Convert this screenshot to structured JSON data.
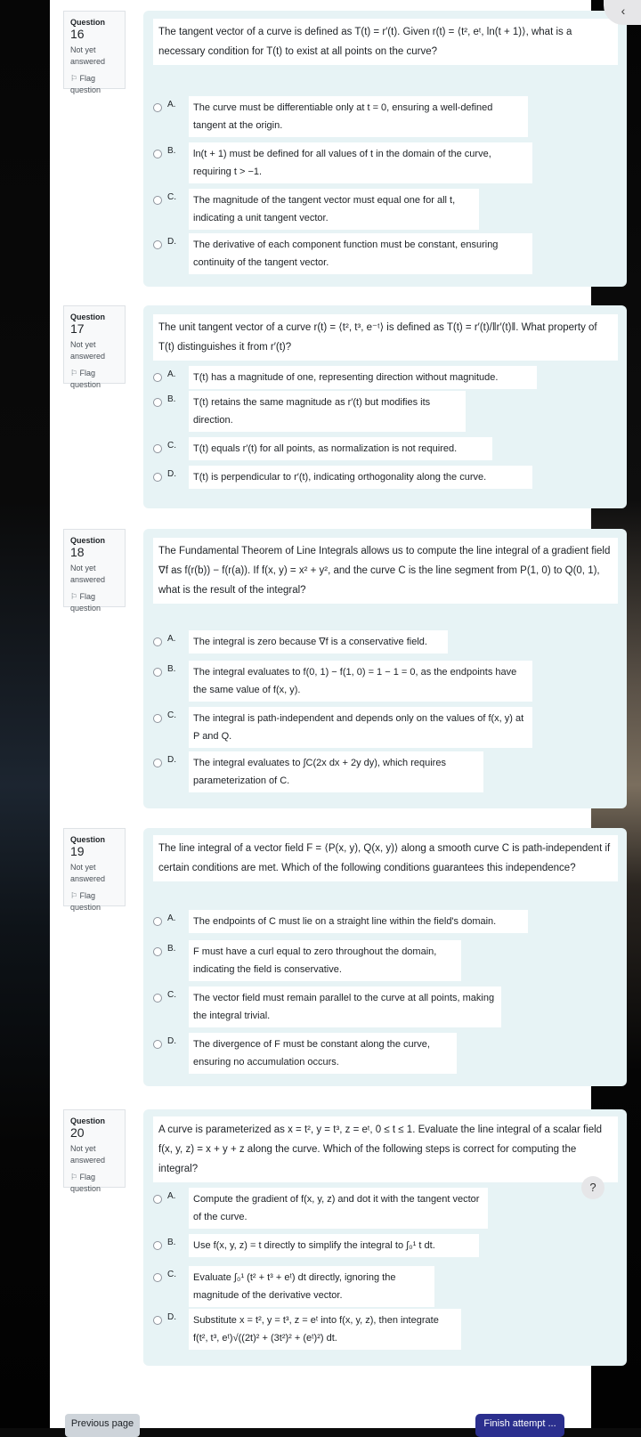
{
  "nav": {
    "back_icon": "chevron-left-icon",
    "help_icon": "question-mark-icon",
    "back_glyph": "‹",
    "help_glyph": "?"
  },
  "questions": [
    {
      "label": "Question",
      "number": "16",
      "status": "Not yet answered",
      "flag": "Flag question",
      "text": "The tangent vector of a curve is defined as T(t) = r′(t). Given r(t) = ⟨t², eᵗ, ln(t + 1)⟩, what is a necessary condition for T(t) to exist at all points on the curve?",
      "options": [
        {
          "letter": "A.",
          "text": "The curve must be differentiable only at t = 0, ensuring a well-defined tangent at the origin."
        },
        {
          "letter": "B.",
          "text": "ln(t + 1) must be defined for all values of t in the domain of the curve, requiring t > −1."
        },
        {
          "letter": "C.",
          "text": "The magnitude of the tangent vector must equal one for all t, indicating a unit tangent vector."
        },
        {
          "letter": "D.",
          "text": "The derivative of each component function must be constant, ensuring continuity of the tangent vector."
        }
      ]
    },
    {
      "label": "Question",
      "number": "17",
      "status": "Not yet answered",
      "flag": "Flag question",
      "text": "The unit tangent vector of a curve r(t) = ⟨t², t³, e⁻ᵗ⟩ is defined as T(t) = r′(t)/‖r′(t)‖. What property of T(t) distinguishes it from r′(t)?",
      "options": [
        {
          "letter": "A.",
          "text": "T(t) has a magnitude of one, representing direction without magnitude."
        },
        {
          "letter": "B.",
          "text": "T(t) retains the same magnitude as r′(t) but modifies its direction."
        },
        {
          "letter": "C.",
          "text": "T(t) equals r′(t) for all points, as normalization is not required."
        },
        {
          "letter": "D.",
          "text": "T(t) is perpendicular to r′(t), indicating orthogonality along the curve."
        }
      ]
    },
    {
      "label": "Question",
      "number": "18",
      "status": "Not yet answered",
      "flag": "Flag question",
      "text": "The Fundamental Theorem of Line Integrals allows us to compute the line integral of a gradient field ∇f as f(r(b)) − f(r(a)). If f(x, y) = x² + y², and the curve C is the line segment from P(1, 0) to Q(0, 1), what is the result of the integral?",
      "options": [
        {
          "letter": "A.",
          "text": "The integral is zero because ∇f is a conservative field."
        },
        {
          "letter": "B.",
          "text": "The integral evaluates to f(0, 1) − f(1, 0) = 1 − 1 = 0, as the endpoints have the same value of f(x, y)."
        },
        {
          "letter": "C.",
          "text": "The integral is path-independent and depends only on the values of f(x, y) at P and Q."
        },
        {
          "letter": "D.",
          "text": "The integral evaluates to ∫C(2x dx + 2y dy), which requires parameterization of C."
        }
      ]
    },
    {
      "label": "Question",
      "number": "19",
      "status": "Not yet answered",
      "flag": "Flag question",
      "text": "The line integral of a vector field F = ⟨P(x, y), Q(x, y)⟩ along a smooth curve C is path-independent if certain conditions are met. Which of the following conditions guarantees this independence?",
      "options": [
        {
          "letter": "A.",
          "text": "The endpoints of C must lie on a straight line within the field's domain."
        },
        {
          "letter": "B.",
          "text": "F must have a curl equal to zero throughout the domain, indicating the field is conservative."
        },
        {
          "letter": "C.",
          "text": "The vector field must remain parallel to the curve at all points, making the integral trivial."
        },
        {
          "letter": "D.",
          "text": "The divergence of F must be constant along the curve, ensuring no accumulation occurs."
        }
      ]
    },
    {
      "label": "Question",
      "number": "20",
      "status": "Not yet answered",
      "flag": "Flag question",
      "text": "A curve is parameterized as x = t², y = t³, z = eᵗ, 0 ≤ t ≤ 1. Evaluate the line integral of a scalar field f(x, y, z) = x + y + z along the curve. Which of the following steps is correct for computing the integral?",
      "options": [
        {
          "letter": "A.",
          "text": "Compute the gradient of f(x, y, z) and dot it with the tangent vector of the curve."
        },
        {
          "letter": "B.",
          "text": "Use f(x, y, z) = t directly to simplify the integral to ∫₀¹ t dt."
        },
        {
          "letter": "C.",
          "text": "Evaluate ∫₀¹ (t² + t³ + eᵗ) dt directly, ignoring the magnitude of the derivative vector."
        },
        {
          "letter": "D.",
          "text": "Substitute x = t², y = t³, z = eᵗ into f(x, y, z), then integrate f(t², t³, eᵗ)√((2t)² + (3t²)² + (eᵗ)²) dt."
        }
      ]
    }
  ],
  "footer": {
    "previous_label": "Previous page",
    "finish_label": "Finish attempt ..."
  },
  "colors": {
    "content_bg": "#e7f3f5",
    "finish_button": "#2b2f8e",
    "previous_button": "#ced4da"
  }
}
